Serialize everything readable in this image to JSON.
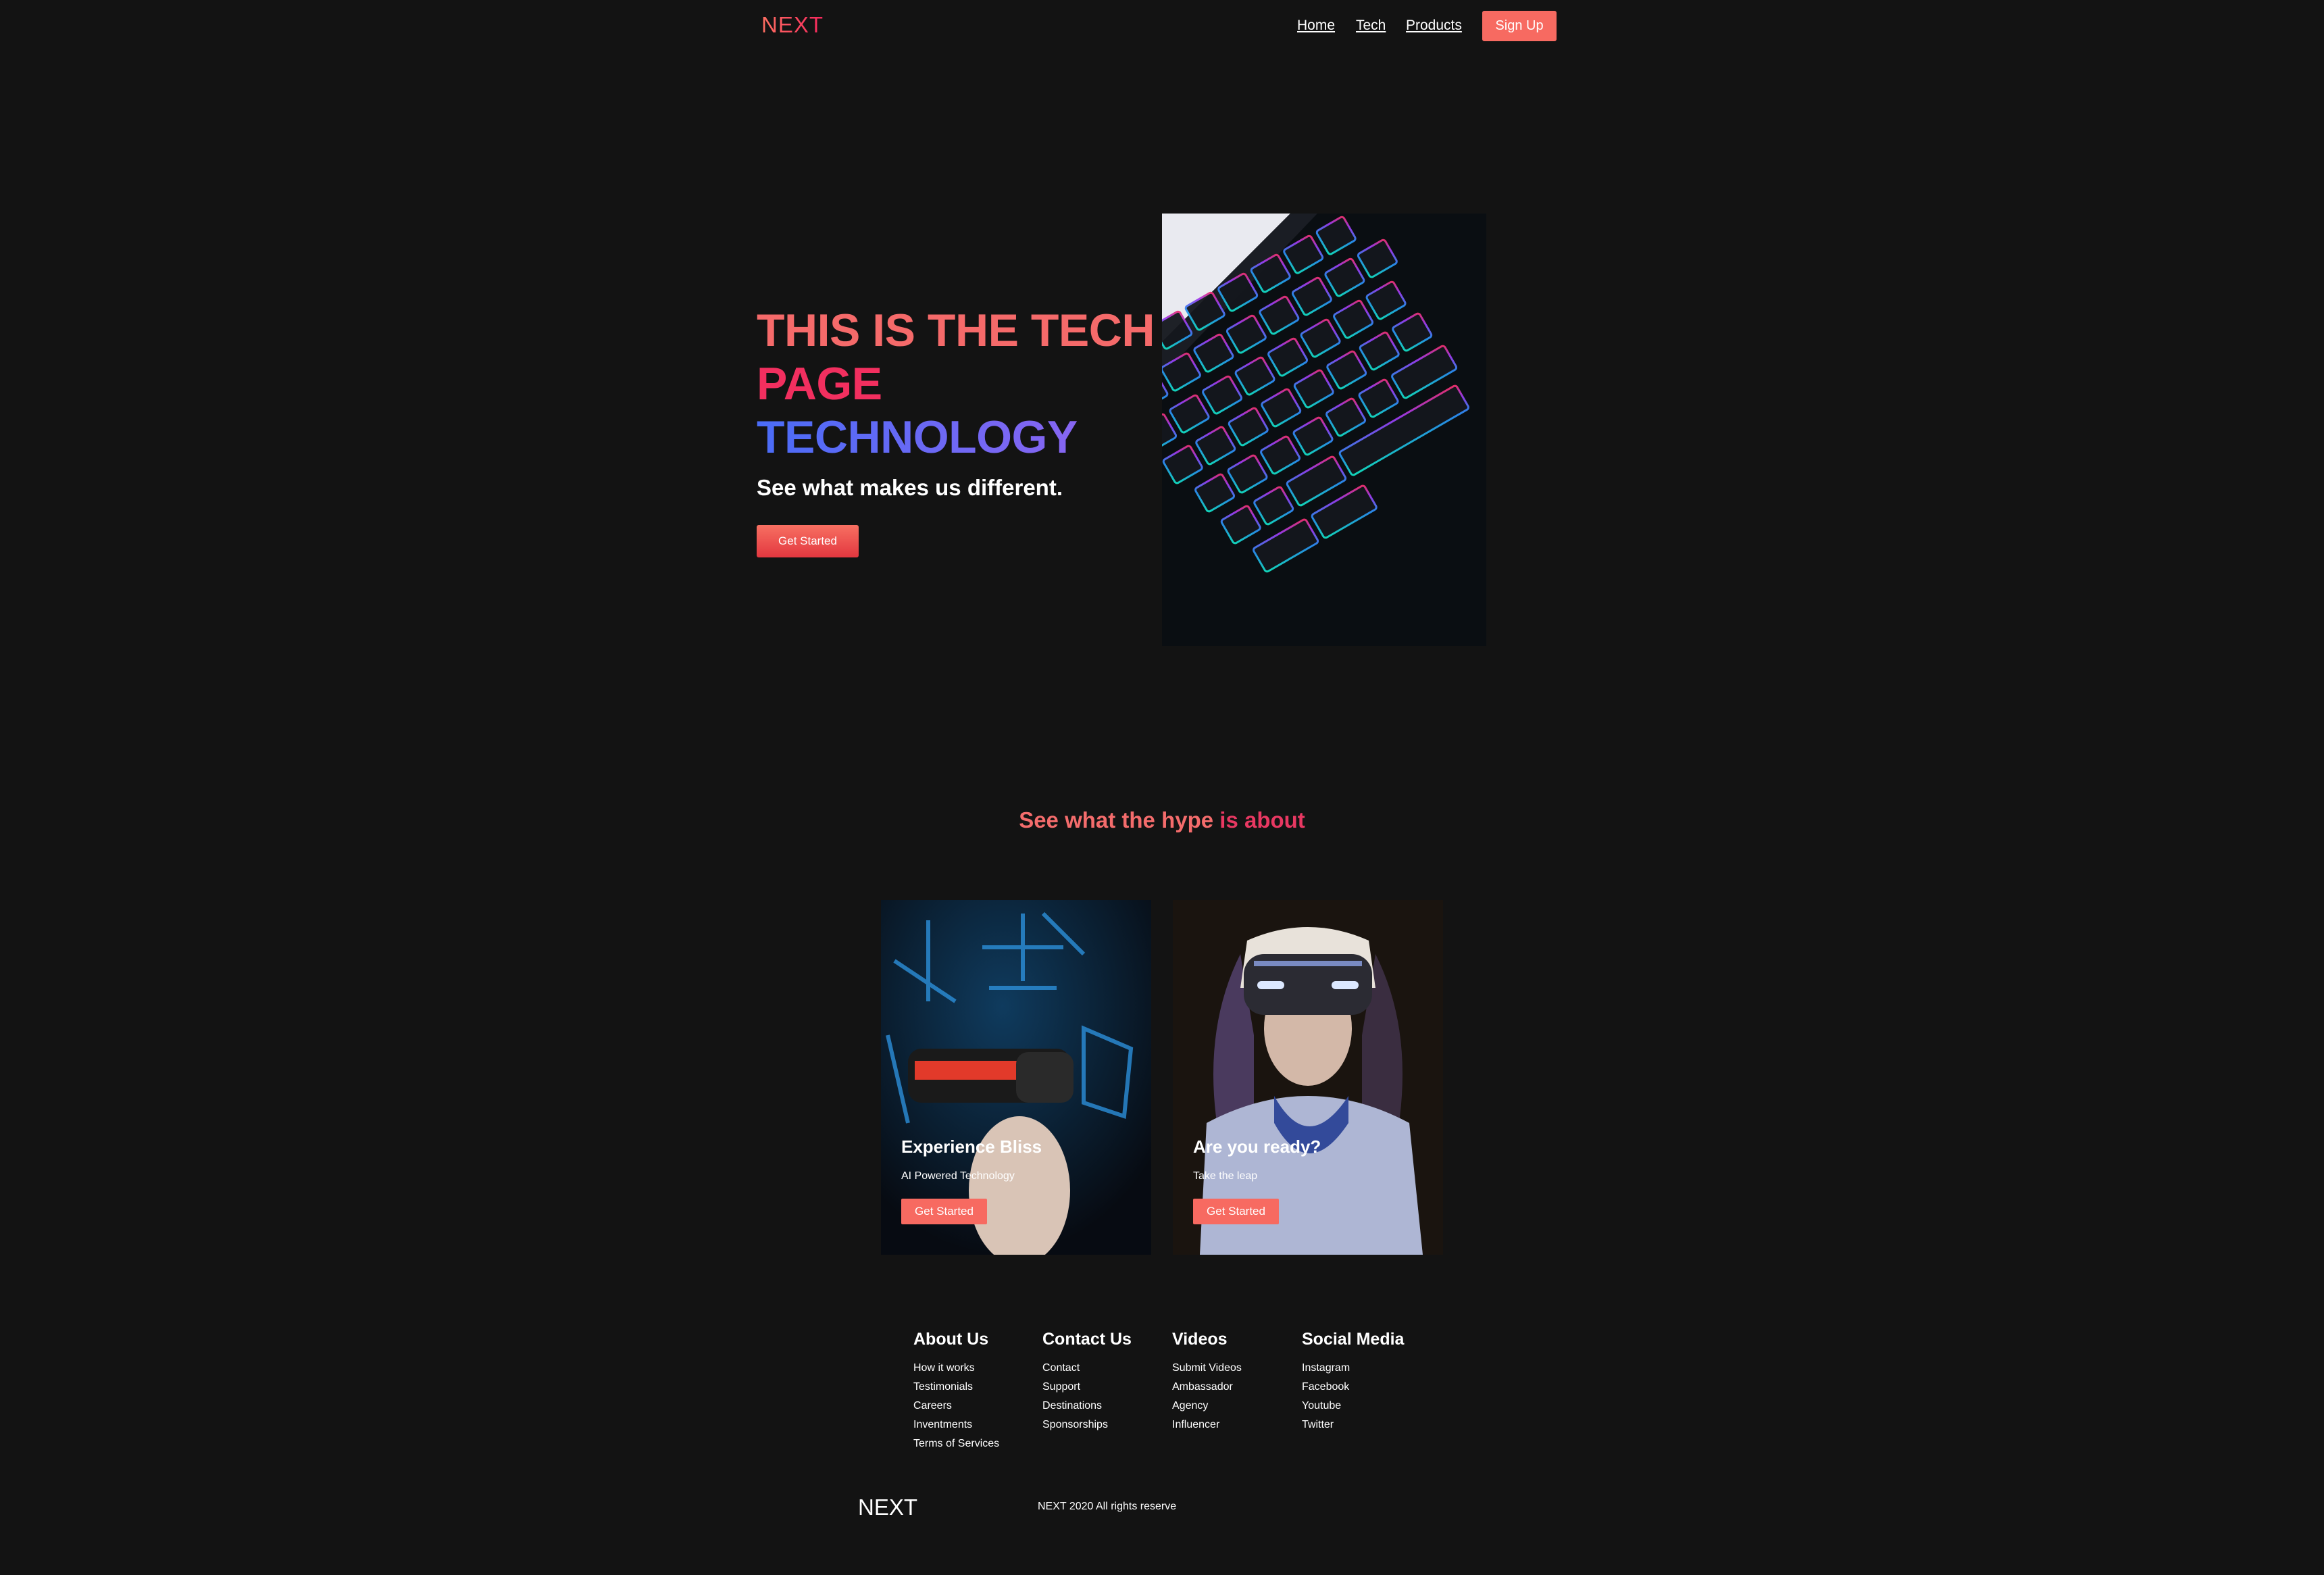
{
  "nav": {
    "logo": "NEXT",
    "links": [
      "Home",
      "Tech",
      "Products"
    ],
    "signup": "Sign Up"
  },
  "hero": {
    "line1": "THIS IS THE TECH",
    "line2": "PAGE",
    "line3": "TECHNOLOGY",
    "subtitle": "See what makes us different.",
    "button": "Get Started",
    "image_icon": "backlit-keyboard-image"
  },
  "hype": {
    "heading_part1": "See what the hype",
    "heading_part2": "is about",
    "cards": [
      {
        "title": "Experience Bliss",
        "desc": "AI Powered Technology",
        "button": "Get Started",
        "image_icon": "vr-headset-man-image"
      },
      {
        "title": "Are you ready?",
        "desc": "Take the leap",
        "button": "Get Started",
        "image_icon": "vr-headset-woman-image"
      }
    ]
  },
  "footer": {
    "columns": [
      {
        "title": "About Us",
        "links": [
          "How it works",
          "Testimonials",
          "Careers",
          "Inventments",
          "Terms of Services"
        ]
      },
      {
        "title": "Contact Us",
        "links": [
          "Contact",
          "Support",
          "Destinations",
          "Sponsorships"
        ]
      },
      {
        "title": "Videos",
        "links": [
          "Submit Videos",
          "Ambassador",
          "Agency",
          "Influencer"
        ]
      },
      {
        "title": "Social Media",
        "links": [
          "Instagram",
          "Facebook",
          "Youtube",
          "Twitter"
        ]
      }
    ],
    "logo": "NEXT",
    "copyright": "NEXT 2020 All rights reserve"
  },
  "colors": {
    "background": "#131313",
    "accent": "#f76a61",
    "pink": "#f22f5f",
    "blue": "#4a6cf7"
  }
}
